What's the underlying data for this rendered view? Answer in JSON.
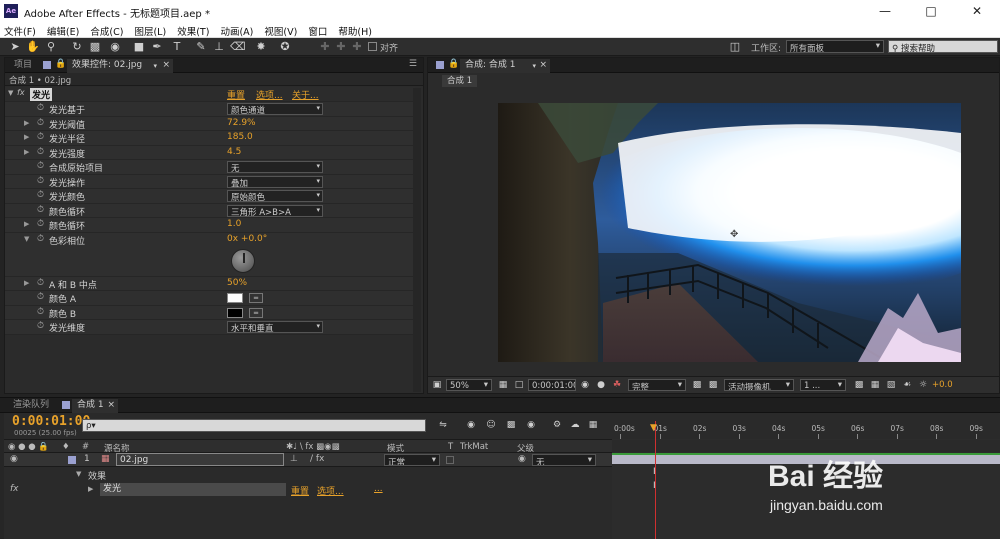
{
  "window": {
    "app_icon": "Ae",
    "title": "Adobe After Effects - 无标题项目.aep *"
  },
  "menu": [
    "文件(F)",
    "编辑(E)",
    "合成(C)",
    "图层(L)",
    "效果(T)",
    "动画(A)",
    "视图(V)",
    "窗口",
    "帮助(H)"
  ],
  "toolbar": {
    "align_label": "对齐",
    "workspace_label": "工作区:",
    "workspace_value": "所有面板",
    "search_placeholder": "搜索帮助"
  },
  "effect_panel": {
    "tabs": [
      "项目",
      "效果控件: 02.jpg"
    ],
    "subheader": "合成 1 • 02.jpg",
    "effect_name": "发光",
    "links": [
      "重置",
      "选项...",
      "关于..."
    ],
    "properties": [
      {
        "name": "发光基于",
        "kind": "dropdown",
        "value": "颜色通道",
        "expand": false
      },
      {
        "name": "发光阈值",
        "kind": "value",
        "value": "72.9%",
        "expand": true
      },
      {
        "name": "发光半径",
        "kind": "value",
        "value": "185.0",
        "expand": true
      },
      {
        "name": "发光强度",
        "kind": "value",
        "value": "4.5",
        "expand": true
      },
      {
        "name": "合成原始项目",
        "kind": "dropdown",
        "value": "无",
        "expand": false
      },
      {
        "name": "发光操作",
        "kind": "dropdown",
        "value": "叠加",
        "expand": false
      },
      {
        "name": "发光颜色",
        "kind": "dropdown",
        "value": "原始颜色",
        "expand": false
      },
      {
        "name": "颜色循环",
        "kind": "dropdown",
        "value": "三角形 A>B>A",
        "expand": false
      },
      {
        "name": "颜色循环",
        "kind": "value",
        "value": "1.0",
        "expand": true
      },
      {
        "name": "色彩相位",
        "kind": "dial",
        "value": "0x +0.0°",
        "expand": true
      },
      {
        "name": "A 和 B 中点",
        "kind": "value",
        "value": "50%",
        "expand": true
      },
      {
        "name": "颜色 A",
        "kind": "color",
        "value": "#ffffff",
        "expand": false
      },
      {
        "name": "颜色 B",
        "kind": "color",
        "value": "#000000",
        "expand": false
      },
      {
        "name": "发光维度",
        "kind": "dropdown",
        "value": "水平和垂直",
        "expand": false
      }
    ]
  },
  "comp_panel": {
    "tab": "合成: 合成 1",
    "subtab": "合成 1",
    "zoom": "50%",
    "time": "0:00:01:00",
    "resolution": "完整",
    "camera": "活动摄像机",
    "views": "1 ...",
    "exposure": "+0.0"
  },
  "timeline": {
    "tabs": [
      "渲染队列",
      "合成 1"
    ],
    "timecode": "0:00:01:00",
    "frame_info": "00025 (25.00 fps)",
    "search_placeholder": "ρ▾",
    "columns": {
      "index": "#",
      "source": "源名称",
      "mode": "模式",
      "t": "T",
      "trkmat": "TrkMat",
      "parent": "父级"
    },
    "layer": {
      "index": "1",
      "name": "02.jpg",
      "mode": "正常",
      "parent": "无"
    },
    "effects_group": "效果",
    "effect_row": {
      "name": "发光",
      "reset": "重置",
      "options": "选项...",
      "more": "..."
    },
    "ruler_labels": [
      "0:00s",
      "01s",
      "02s",
      "03s",
      "04s",
      "05s",
      "06s",
      "07s",
      "08s",
      "09s"
    ]
  },
  "watermark": {
    "brand": "Bai 经验",
    "url": "jingyan.baidu.com"
  },
  "colors": {
    "accent_orange": "#e8a22a",
    "panel_bg": "#2b2b2b",
    "timeline_bar": "#b9b9c9"
  }
}
